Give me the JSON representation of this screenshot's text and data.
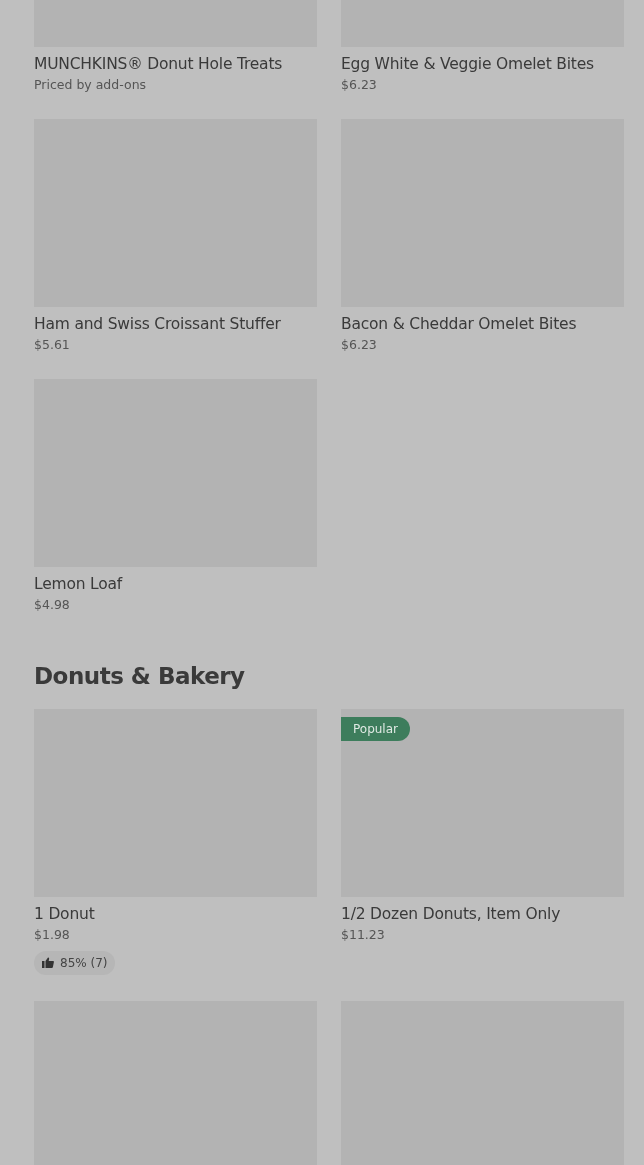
{
  "sections": [
    {
      "items": [
        {
          "kind": "product",
          "name": "MUNCHKINS® Donut Hole Treats",
          "price": "Priced by add-ons"
        },
        {
          "kind": "product",
          "name": "Egg White & Veggie Omelet Bites",
          "price": "$6.23"
        },
        {
          "kind": "product",
          "name": "Ham and Swiss Croissant Stuffer",
          "price": "$5.61"
        },
        {
          "kind": "product",
          "name": "Bacon & Cheddar Omelet Bites",
          "price": "$6.23"
        },
        {
          "kind": "product",
          "name": "Lemon Loaf",
          "price": "$4.98"
        }
      ]
    },
    {
      "title": "Donuts & Bakery",
      "items": [
        {
          "kind": "product",
          "name": "1 Donut",
          "price": "$1.98",
          "rating": "85% (7)"
        },
        {
          "kind": "product",
          "name": "1/2 Dozen Donuts, Item Only",
          "price": "$11.23",
          "badge": "Popular"
        },
        {
          "kind": "image_only"
        },
        {
          "kind": "image_only"
        }
      ]
    }
  ]
}
